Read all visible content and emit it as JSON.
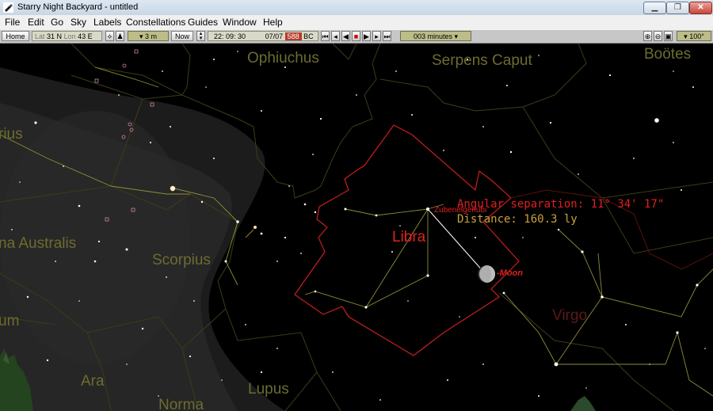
{
  "window": {
    "title": "Starry Night Backyard - untitled"
  },
  "window_controls": {
    "minimize": "▁",
    "maximize": "❐",
    "close": "✕"
  },
  "menu": [
    "File",
    "Edit",
    "Go",
    "Sky",
    "Labels",
    "Constellations",
    "Guides",
    "Window",
    "Help"
  ],
  "toolbar": {
    "home": "Home",
    "lat_label": "Lat",
    "lat_value": "31 N",
    "lon_label": "Lon",
    "lon_value": "43 E",
    "elevation": "▾ 3 m",
    "now": "Now",
    "time": "22: 09: 30",
    "date": "07/07",
    "year": "588",
    "era": "BC",
    "time_step": "003 minutes ▾",
    "field_of_view": "▾ 100°"
  },
  "sky": {
    "constellation_labels": [
      "Ophiuchus",
      "Serpens Caput",
      "Boötes",
      "rius",
      "na Australis",
      "Scorpius",
      "Libra",
      "Virgo",
      "um",
      "Ara",
      "Lupus",
      "Norma"
    ],
    "star_label": "Zubenelgenubi",
    "moon_label": "Moon",
    "angular_separation": "Angular separation: 11° 34' 17\"",
    "distance": "Distance: 160.3 ly",
    "highlight_color": "#cc1a1a",
    "line_color": "#b9b94d",
    "label_color": "#6c6c30"
  }
}
